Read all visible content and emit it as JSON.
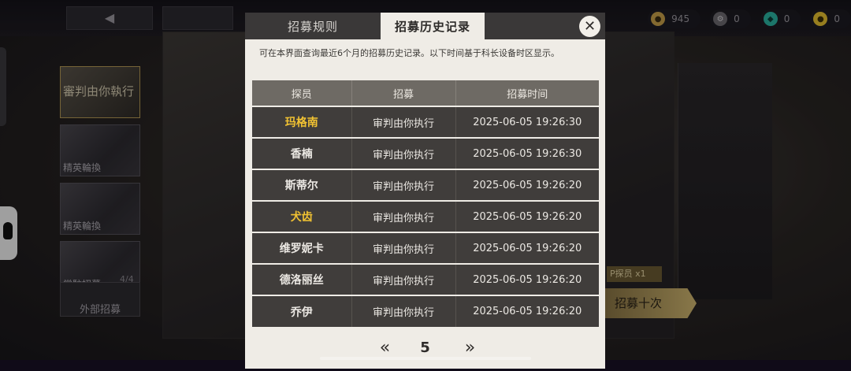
{
  "header": {
    "currencies": [
      {
        "icon": "gold-coin-icon",
        "value": "945",
        "color": "#c9a24a"
      },
      {
        "icon": "gear-token-icon",
        "value": "0",
        "color": "#8a8a8a"
      },
      {
        "icon": "teal-gem-icon",
        "value": "0",
        "color": "#2bb6a4"
      },
      {
        "icon": "yellow-orb-icon",
        "value": "0",
        "color": "#e8c230"
      }
    ]
  },
  "background": {
    "banners": [
      {
        "label": "審判由你執行",
        "active": true
      },
      {
        "label": "精英輪換"
      },
      {
        "label": "精英輪換"
      },
      {
        "label": "常駐招募"
      }
    ],
    "outside_recruit_label": "外部招募",
    "outside_recruit_count": "4/4",
    "pull_ten_label": "招募十次",
    "ticket_label": "P探员 x1"
  },
  "modal": {
    "tabs": {
      "rules": "招募规则",
      "history": "招募历史记录"
    },
    "close_glyph": "✕",
    "notice": "可在本界面查询最近6个月的招募历史记录。以下时间基于科长设备时区显示。",
    "columns": {
      "agent": "探员",
      "pool": "招募",
      "time": "招募时间"
    },
    "rows": [
      {
        "agent": "玛格南",
        "pool": "审判由你执行",
        "time": "2025-06-05 19:26:30",
        "rare": true
      },
      {
        "agent": "香楠",
        "pool": "审判由你执行",
        "time": "2025-06-05 19:26:30",
        "rare": false
      },
      {
        "agent": "斯蒂尔",
        "pool": "审判由你执行",
        "time": "2025-06-05 19:26:20",
        "rare": false
      },
      {
        "agent": "犬齿",
        "pool": "审判由你执行",
        "time": "2025-06-05 19:26:20",
        "rare": true
      },
      {
        "agent": "维罗妮卡",
        "pool": "审判由你执行",
        "time": "2025-06-05 19:26:20",
        "rare": false
      },
      {
        "agent": "德洛丽丝",
        "pool": "审判由你执行",
        "time": "2025-06-05 19:26:20",
        "rare": false
      },
      {
        "agent": "乔伊",
        "pool": "审判由你执行",
        "time": "2025-06-05 19:26:20",
        "rare": false
      }
    ],
    "pager": {
      "prev_glyph": "«",
      "page": "5",
      "next_glyph": "»"
    },
    "colors": {
      "rare_agent": "#f1c232",
      "row_bg": "#403d3b",
      "header_bg": "#6e6a64",
      "panel_bg": "#efece6"
    }
  }
}
